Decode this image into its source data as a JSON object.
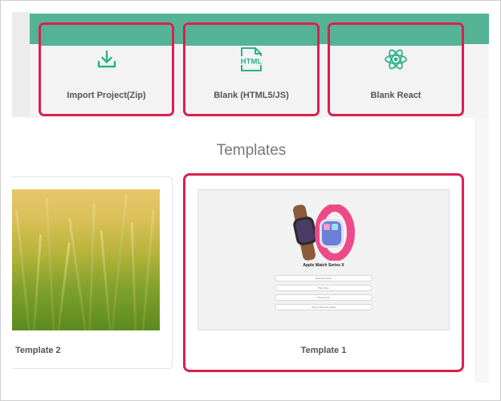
{
  "cards": [
    {
      "label": "Import Project(Zip)",
      "icon": "download-icon"
    },
    {
      "label": "Blank (HTML5/JS)",
      "icon": "html-file-icon",
      "icon_text": "HTML"
    },
    {
      "label": "Blank React",
      "icon": "react-icon"
    }
  ],
  "templates": {
    "title": "Templates",
    "items": [
      {
        "label": "Template 2",
        "image": "wheat-field-photo"
      },
      {
        "label": "Template 1",
        "image": "apple-watch-page-preview"
      }
    ],
    "preview": {
      "heading": "Apple Watch Series X",
      "buttons": [
        "Book test drive",
        "Play video",
        "Product info",
        "View retail & Pro plans"
      ]
    }
  },
  "colors": {
    "accent_green": "#54b394",
    "highlight_red": "#d9204f"
  }
}
